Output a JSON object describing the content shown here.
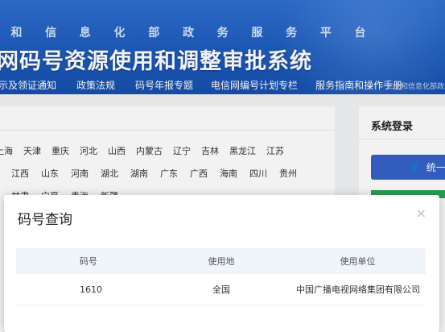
{
  "header": {
    "subtitle_chars": [
      "和",
      "信",
      "息",
      "化",
      "部",
      "政",
      "务",
      "服",
      "务",
      "平",
      "台"
    ],
    "title": "网码号资源使用和调整审批系统",
    "nav": [
      "示及领证通知",
      "政策法规",
      "码号年报专题",
      "电信网编号计划专栏",
      "服务指南和操作手册"
    ],
    "nav_extra": "工业和信息化部政务"
  },
  "provinces": {
    "row1": [
      "上海",
      "天津",
      "重庆",
      "河北",
      "山西",
      "内蒙古",
      "辽宁",
      "吉林",
      "黑龙江",
      "江苏"
    ],
    "row2": [
      "江西",
      "山东",
      "河南",
      "湖北",
      "湖南",
      "广东",
      "广西",
      "海南",
      "四川",
      "贵州"
    ],
    "row3": [
      "甘肃",
      "宁夏",
      "青海",
      "新疆"
    ]
  },
  "login": {
    "title": "系统登录",
    "button": "统一身"
  },
  "modal": {
    "title": "码号查询",
    "close_symbol": "×",
    "columns": [
      "码号",
      "使用地",
      "使用单位"
    ],
    "rows": [
      [
        "1610",
        "全国",
        "中国广播电视网络集团有限公司"
      ]
    ]
  },
  "colors": {
    "banner": "#1d5bbd",
    "login_button": "#3563c9",
    "green": "#2aa55a",
    "table_header": "#f0f5fb"
  }
}
